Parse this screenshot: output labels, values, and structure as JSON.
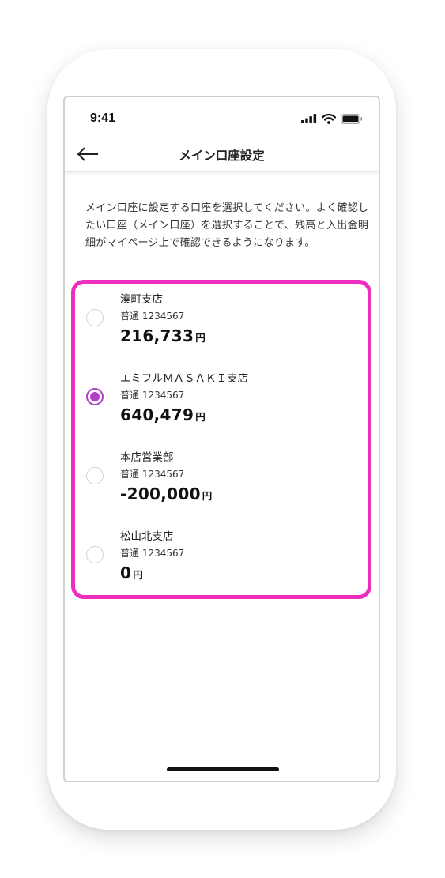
{
  "status_bar": {
    "time": "9:41",
    "icons": [
      "signal-icon",
      "wifi-icon",
      "battery-icon"
    ]
  },
  "nav": {
    "title": "メイン口座設定",
    "back_icon": "arrow-left-icon"
  },
  "description": "メイン口座に設定する口座を選択してください。よく確認したい口座（メイン口座）を選択することで、残高と入出金明細がマイページ上で確認できるようになります。",
  "accounts": [
    {
      "branch": "湊町支店",
      "account": "普通 1234567",
      "balance": "216,733",
      "currency": "円",
      "selected": false
    },
    {
      "branch": "エミフルＭＡＳＡＫＩ支店",
      "account": "普通 1234567",
      "balance": "640,479",
      "currency": "円",
      "selected": true
    },
    {
      "branch": "本店営業部",
      "account": "普通 1234567",
      "balance": "-200,000",
      "currency": "円",
      "selected": false
    },
    {
      "branch": "松山北支店",
      "account": "普通 1234567",
      "balance": "0",
      "currency": "円",
      "selected": false
    }
  ],
  "colors": {
    "highlight_border": "#ee2ebf",
    "radio_selected": "#b040c8"
  }
}
